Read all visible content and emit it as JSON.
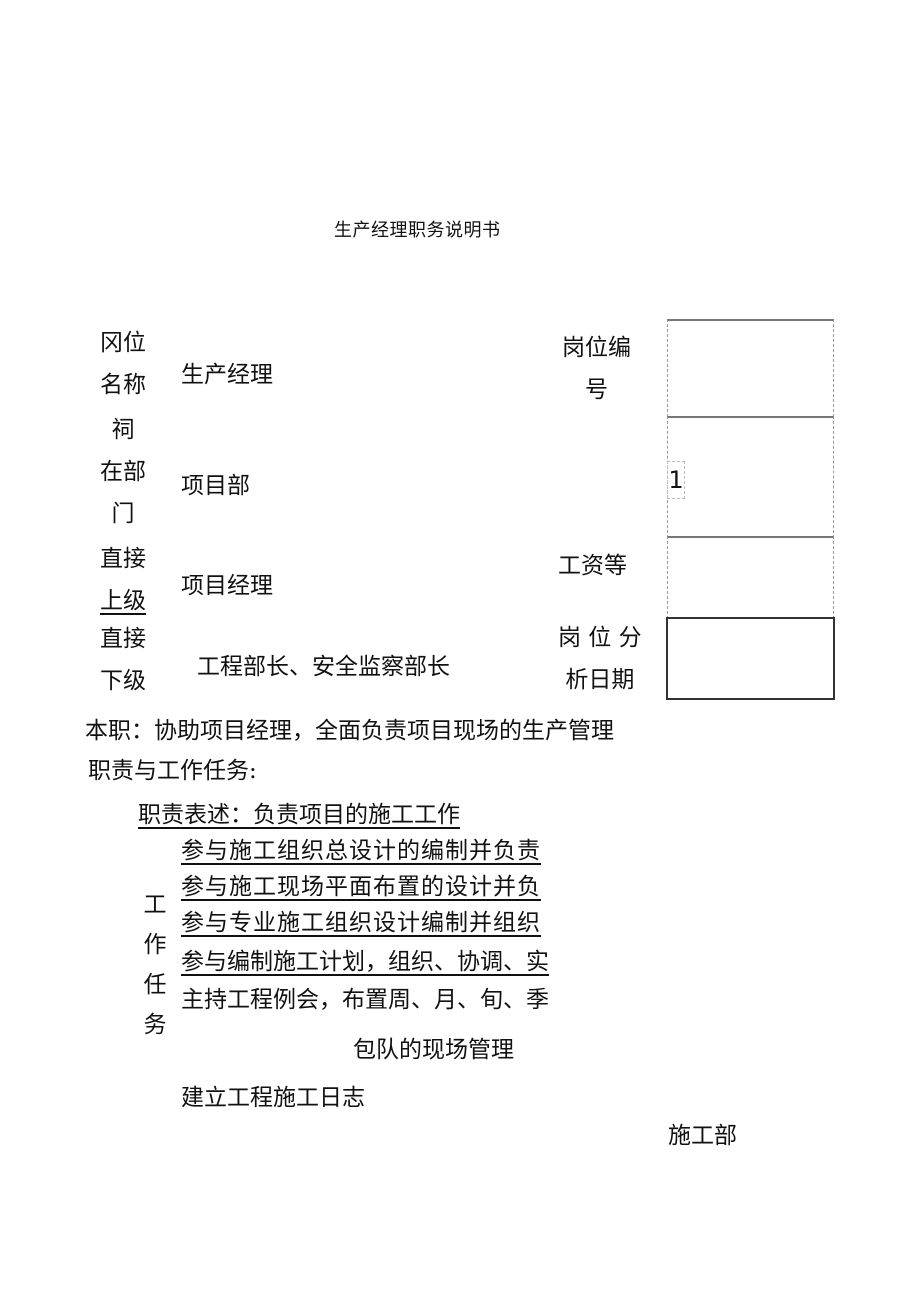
{
  "document": {
    "title": "生产经理职务说明书",
    "table": {
      "position_name": {
        "label_line1": "冈位",
        "label_line2": "名称",
        "value": "生产经理"
      },
      "department": {
        "label_line1": "祠",
        "label_line2": "在部",
        "label_line3": "门",
        "value": "项目部"
      },
      "superior": {
        "label_line1": "直接",
        "label_line2": "上级",
        "value": "项目经理"
      },
      "subordinate": {
        "label_line1": "直接",
        "label_line2": "下级",
        "value": "工程部长、安全监察部长"
      },
      "position_code": {
        "label_line1": "岗位编",
        "label_line2": "号",
        "value": ""
      },
      "department_count": {
        "value": "1"
      },
      "salary_grade": {
        "label": "工资等",
        "value": ""
      },
      "analysis_date": {
        "label_line1": "岗 位 分",
        "label_line2": "析日期",
        "value": ""
      }
    },
    "duty_summary": "本职：协助项目经理，全面负责项目现场的生产管理",
    "responsibilities_heading": "职责与工作任务:",
    "duty_statement": "职责表述：负责项目的施工工作",
    "work_tasks_label": [
      "工",
      "作",
      "任",
      "务"
    ],
    "tasks": [
      "参与施工组织总设计的编制并负责",
      "参与施工现场平面布置的设计并负",
      "参与专业施工组织设计编制并组织",
      "参与编制施工计划，组织、协调、实",
      "主持工程例会，布置周、月、旬、季"
    ],
    "task_continuation": "包队的现场管理",
    "task_last": "建立工程施工日志",
    "footer_department": "施工部"
  }
}
